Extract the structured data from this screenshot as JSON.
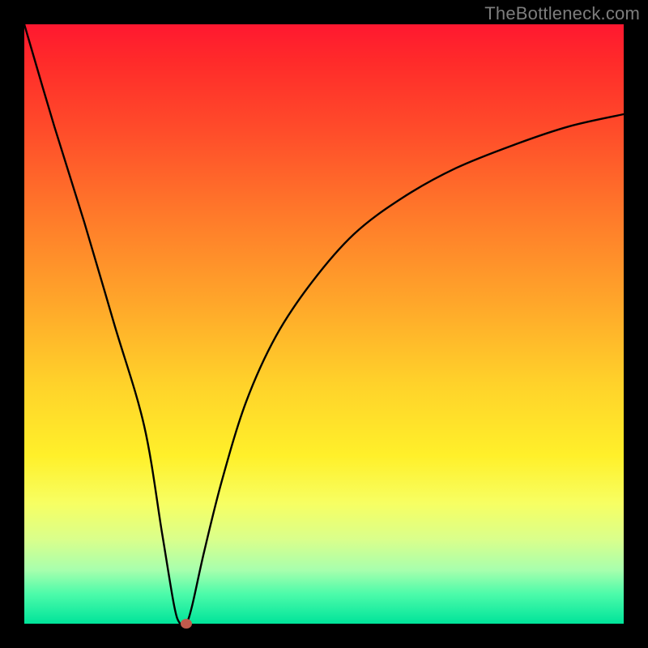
{
  "watermark": "TheBottleneck.com",
  "chart_data": {
    "type": "line",
    "title": "",
    "xlabel": "",
    "ylabel": "",
    "xlim": [
      0,
      100
    ],
    "ylim": [
      0,
      100
    ],
    "grid": false,
    "legend": false,
    "series": [
      {
        "name": "bottleneck-curve",
        "x": [
          0,
          5,
          10,
          15,
          20,
          23,
          25,
          26,
          27,
          28,
          30,
          33,
          37,
          42,
          48,
          55,
          63,
          72,
          82,
          91,
          100
        ],
        "values": [
          100,
          83,
          67,
          50,
          33,
          15,
          3,
          0,
          0,
          3,
          12,
          24,
          37,
          48,
          57,
          65,
          71,
          76,
          80,
          83,
          85
        ]
      }
    ],
    "marker": {
      "x": 27,
      "y": 0,
      "color": "#c15a4c"
    },
    "background_gradient": {
      "direction": "vertical",
      "stops": [
        {
          "pos": 0,
          "color": "#ff1830"
        },
        {
          "pos": 18,
          "color": "#ff4d2a"
        },
        {
          "pos": 46,
          "color": "#ffa52a"
        },
        {
          "pos": 72,
          "color": "#fff02a"
        },
        {
          "pos": 91,
          "color": "#a8ffad"
        },
        {
          "pos": 100,
          "color": "#00e49a"
        }
      ]
    }
  }
}
